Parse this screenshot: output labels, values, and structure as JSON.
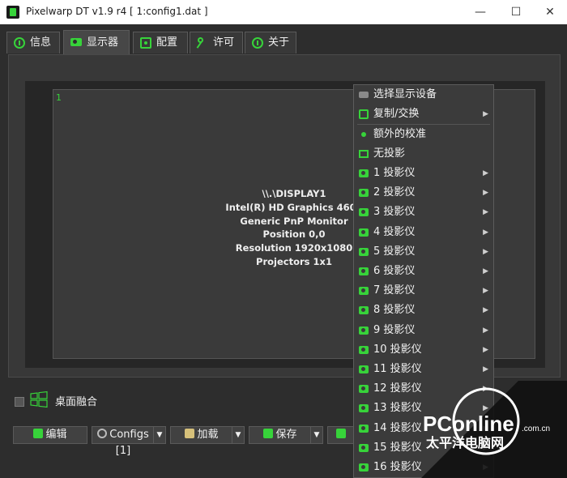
{
  "window": {
    "title": "Pixelwarp DT v1.9 r4 [ 1:config1.dat ]",
    "minimize": "—",
    "maximize": "☐",
    "close": "✕"
  },
  "tabs": [
    {
      "label": "信息",
      "icon": "info-icon"
    },
    {
      "label": "显示器",
      "icon": "projector-icon",
      "active": true
    },
    {
      "label": "配置",
      "icon": "config-icon"
    },
    {
      "label": "许可",
      "icon": "key-icon"
    },
    {
      "label": "关于",
      "icon": "info-icon"
    }
  ],
  "display": {
    "index": "1",
    "info": [
      "\\\\.\\DISPLAY1",
      "Intel(R) HD Graphics 4600",
      "Generic PnP Monitor",
      "Position 0,0",
      "Resolution 1920x1080",
      "Projectors 1x1"
    ]
  },
  "blend": {
    "label": "桌面融合",
    "checked": false
  },
  "buttons": {
    "edit": "编辑",
    "configs": "Configs [1]",
    "load": "加载",
    "save": "保存"
  },
  "menu": {
    "select_device": "选择显示设备",
    "copy_swap": "复制/交换",
    "extra_calibration": "额外的校准",
    "no_projection": "无投影",
    "projectors": [
      "1 投影仪",
      "2 投影仪",
      "3 投影仪",
      "4 投影仪",
      "5 投影仪",
      "6 投影仪",
      "7 投影仪",
      "8 投影仪",
      "9 投影仪",
      "10 投影仪",
      "11 投影仪",
      "12 投影仪",
      "13 投影仪",
      "14 投影仪",
      "15 投影仪",
      "16 投影仪"
    ]
  },
  "watermark": {
    "brand": "PConline",
    "domain": ".com.cn",
    "tagline": "太平洋电脑网"
  },
  "colors": {
    "accent": "#37d33a",
    "background": "#2d2d2d",
    "panel": "#383838"
  }
}
